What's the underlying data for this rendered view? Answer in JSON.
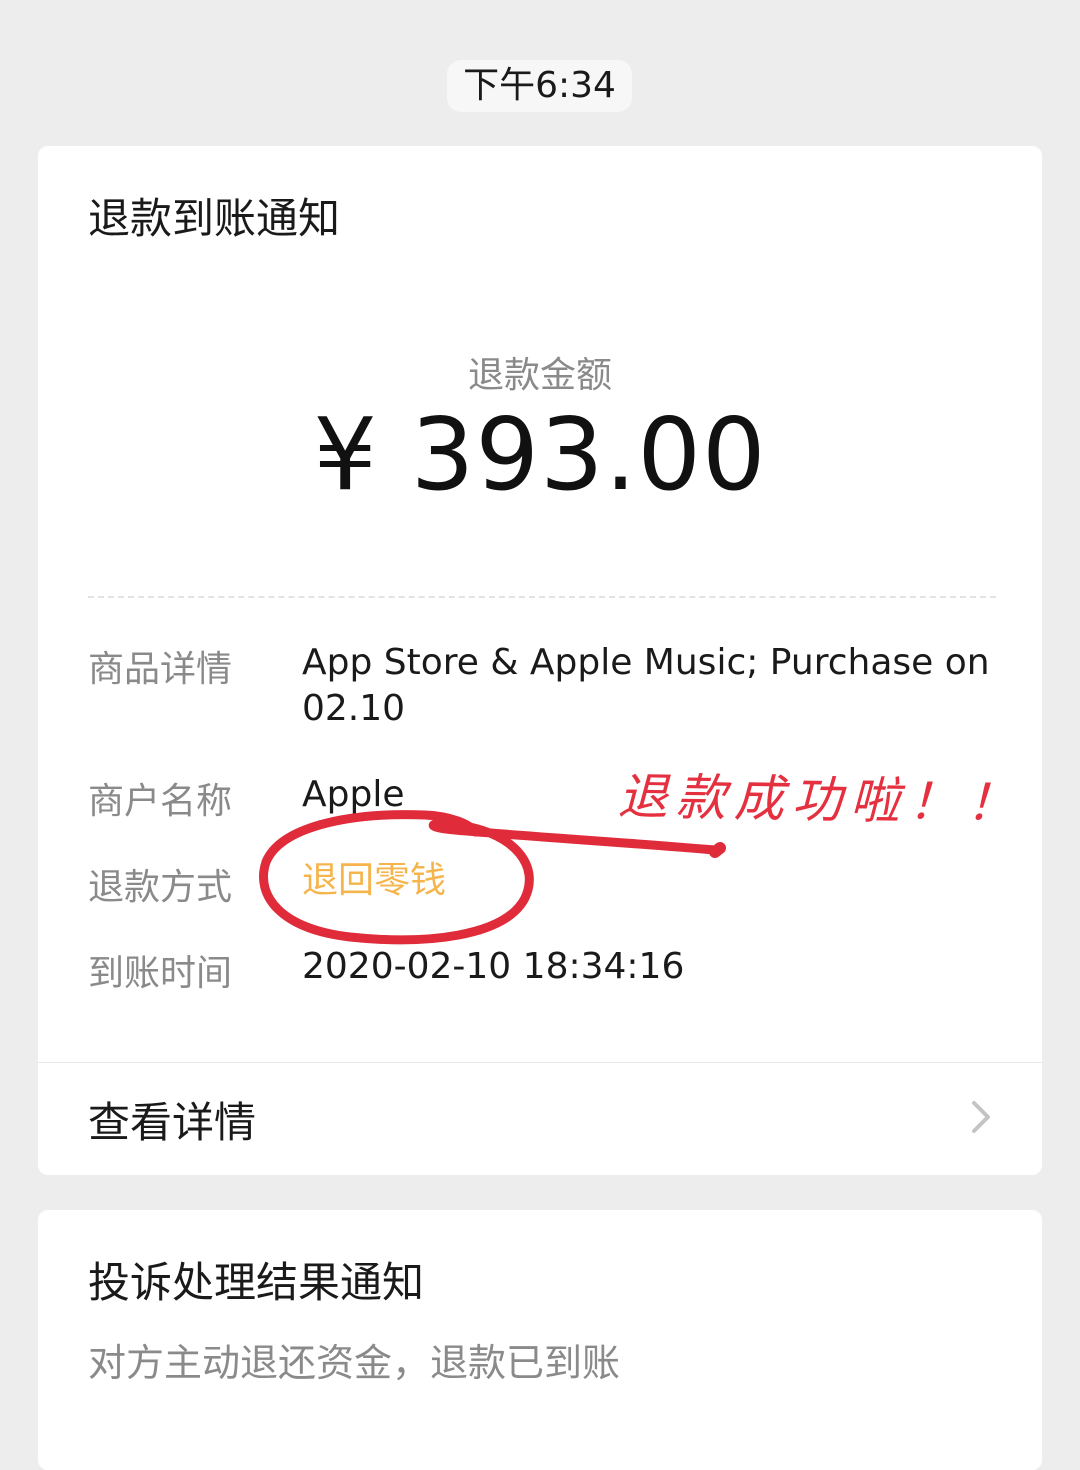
{
  "status_time": "下午6:34",
  "refund_card": {
    "title": "退款到账通知",
    "amount_label": "退款金额",
    "amount": "¥ 393.00",
    "details": {
      "goods_label": "商品详情",
      "goods_value": "App Store & Apple Music; Purchase on 02.10",
      "merchant_label": "商户名称",
      "merchant_value": "Apple",
      "method_label": "退款方式",
      "method_value": "退回零钱",
      "time_label": "到账时间",
      "time_value": "2020-02-10 18:34:16"
    },
    "view_detail": "查看详情"
  },
  "complaint_card": {
    "title": "投诉处理结果通知",
    "subtitle": "对方主动退还资金，退款已到账"
  },
  "annotation": {
    "text": "退款成功啦！！",
    "color": "#e53040"
  },
  "colors": {
    "background": "#ededed",
    "card": "#ffffff",
    "highlight": "#f5b54c"
  },
  "icons": {
    "view_detail_chevron": "chevron-right-icon"
  }
}
